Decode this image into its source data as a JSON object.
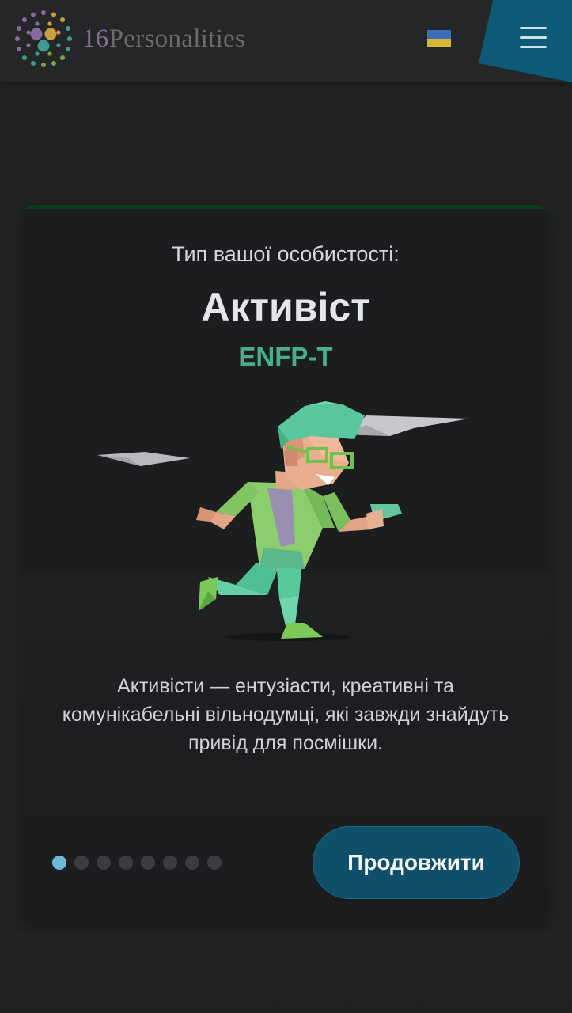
{
  "header": {
    "logo_number": "16",
    "logo_word": "Personalities",
    "flag_icon": "ukraine-flag-icon",
    "menu_icon": "hamburger-menu-icon",
    "accent_color": "#0c5a78"
  },
  "card": {
    "subtitle": "Тип вашої особистості:",
    "type_name": "Активіст",
    "type_code": "ENFP-T",
    "type_code_color": "#48b089",
    "illustration_icon": "running-activist-character-illustration",
    "description": "Активісти — ентузіасти, креативні та комунікабельні вільнодумці, які завжди знайдуть привід для посмішки.",
    "pagination": {
      "total": 8,
      "current": 1,
      "active_color": "#6ab9d8"
    },
    "continue_label": "Продовжити",
    "button_color": "#0f4f69"
  }
}
